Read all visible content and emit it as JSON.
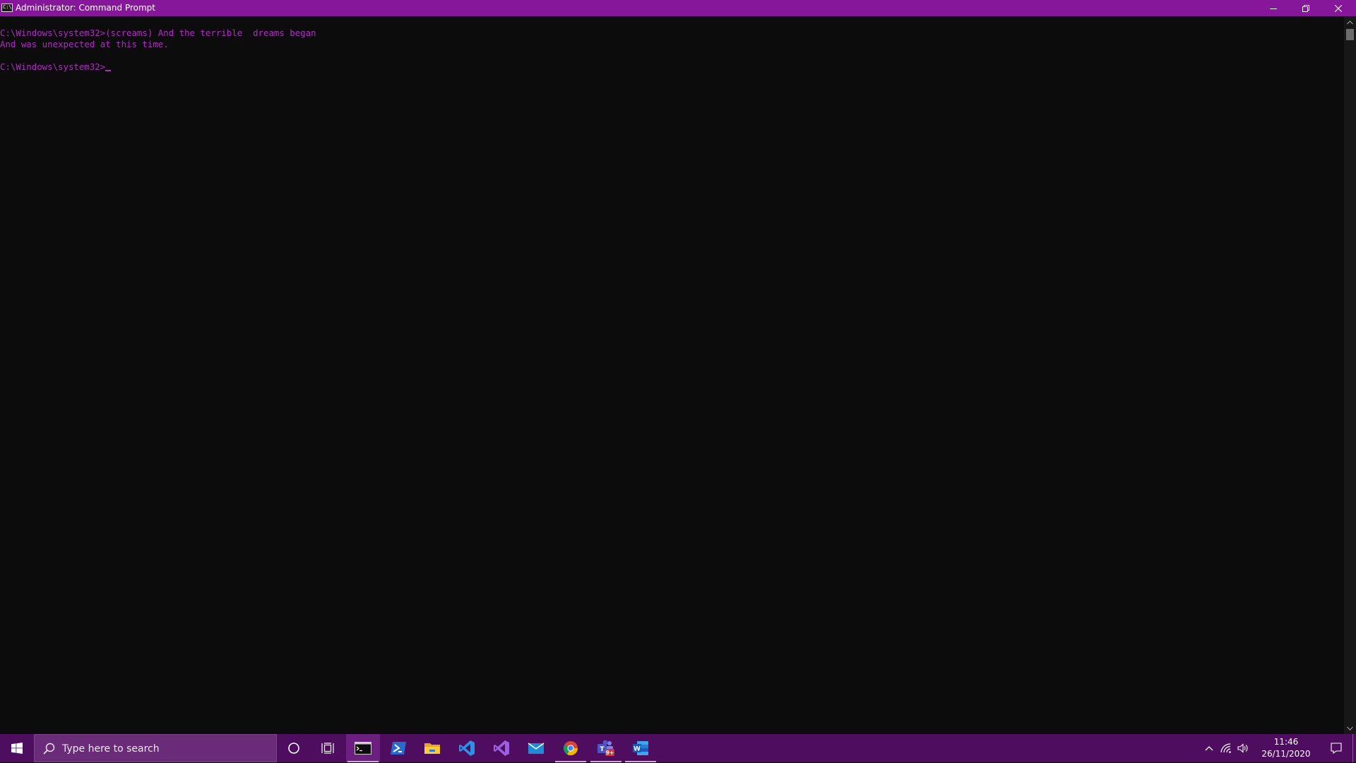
{
  "window": {
    "title": "Administrator: Command Prompt",
    "icon_text": "C:\\_",
    "accent_color": "#86179a"
  },
  "console": {
    "text_color": "#b02cc5",
    "lines": [
      "C:\\Windows\\system32>(screams) And the terrible  dreams began",
      "And was unexpected at this time.",
      "",
      "C:\\Windows\\system32>"
    ]
  },
  "taskbar": {
    "search_placeholder": "Type here to search",
    "apps": [
      "command-prompt",
      "powershell",
      "file-explorer",
      "vs-code",
      "visual-studio",
      "mail",
      "chrome",
      "teams",
      "word"
    ],
    "teams_badge": "9+",
    "word_letter": "W",
    "teams_letter": "T",
    "clock": {
      "time": "11:46",
      "date": "26/11/2020"
    }
  }
}
